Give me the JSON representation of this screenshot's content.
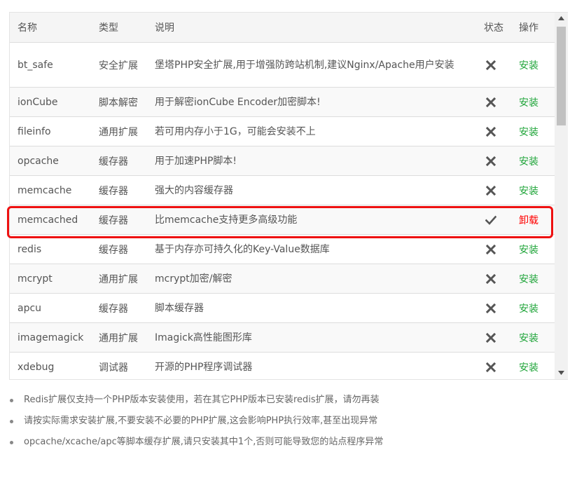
{
  "table": {
    "headers": {
      "name": "名称",
      "type": "类型",
      "desc": "说明",
      "status": "状态",
      "action": "操作"
    },
    "rows": [
      {
        "name": "bt_safe",
        "type": "安全扩展",
        "desc": "堡塔PHP安全扩展,用于增强防跨站机制,建议Nginx/Apache用户安装",
        "installed": false,
        "action": "安装"
      },
      {
        "name": "ionCube",
        "type": "脚本解密",
        "desc": "用于解密ionCube Encoder加密脚本!",
        "installed": false,
        "action": "安装"
      },
      {
        "name": "fileinfo",
        "type": "通用扩展",
        "desc": "若可用内存小于1G，可能会安装不上",
        "installed": false,
        "action": "安装"
      },
      {
        "name": "opcache",
        "type": "缓存器",
        "desc": "用于加速PHP脚本!",
        "installed": false,
        "action": "安装"
      },
      {
        "name": "memcache",
        "type": "缓存器",
        "desc": "强大的内容缓存器",
        "installed": false,
        "action": "安装"
      },
      {
        "name": "memcached",
        "type": "缓存器",
        "desc": "比memcache支持更多高级功能",
        "installed": true,
        "action": "卸载"
      },
      {
        "name": "redis",
        "type": "缓存器",
        "desc": "基于内存亦可持久化的Key-Value数据库",
        "installed": false,
        "action": "安装"
      },
      {
        "name": "mcrypt",
        "type": "通用扩展",
        "desc": "mcrypt加密/解密",
        "installed": false,
        "action": "安装"
      },
      {
        "name": "apcu",
        "type": "缓存器",
        "desc": "脚本缓存器",
        "installed": false,
        "action": "安装"
      },
      {
        "name": "imagemagick",
        "type": "通用扩展",
        "desc": "Imagick高性能图形库",
        "installed": false,
        "action": "安装"
      },
      {
        "name": "xdebug",
        "type": "调试器",
        "desc": "开源的PHP程序调试器",
        "installed": false,
        "action": "安装"
      }
    ]
  },
  "notes": [
    "Redis扩展仅支持一个PHP版本安装使用，若在其它PHP版本已安装redis扩展，请勿再装",
    "请按实际需求安装扩展,不要安装不必要的PHP扩展,这会影响PHP执行效率,甚至出现异常",
    "opcache/xcache/apc等脚本缓存扩展,请只安装其中1个,否则可能导致您的站点程序异常"
  ],
  "colors": {
    "install": "#20a53a",
    "uninstall": "#ff0000",
    "highlight": "#ee1111",
    "icon": "#555555"
  },
  "icons": {
    "installed": "check-icon",
    "not_installed": "cross-icon"
  }
}
